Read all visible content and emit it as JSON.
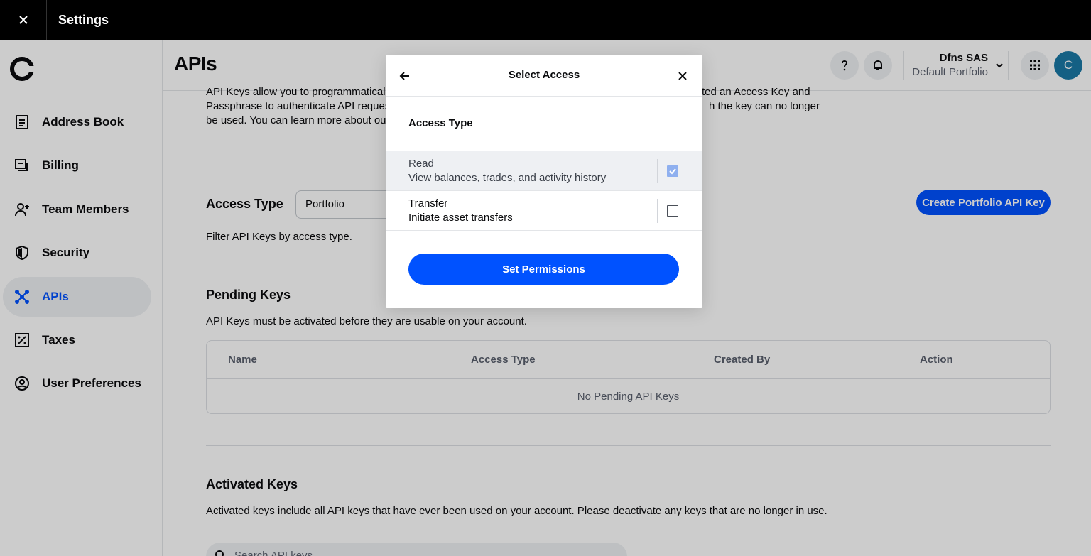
{
  "window": {
    "title": "Settings"
  },
  "sidebar": {
    "items": [
      {
        "label": "Address Book",
        "icon": "address-book-icon"
      },
      {
        "label": "Billing",
        "icon": "billing-icon"
      },
      {
        "label": "Team Members",
        "icon": "team-members-icon"
      },
      {
        "label": "Security",
        "icon": "shield-icon"
      },
      {
        "label": "APIs",
        "icon": "api-icon",
        "active": true
      },
      {
        "label": "Taxes",
        "icon": "taxes-icon"
      },
      {
        "label": "User Preferences",
        "icon": "user-circle-icon"
      }
    ]
  },
  "header": {
    "title": "APIs",
    "account_name": "Dfns SAS",
    "account_sub": "Default Portfolio",
    "avatar_letter": "C"
  },
  "main": {
    "intro_line1": "API Keys allow you to programmaticall",
    "intro_line1_right": "ted an Access Key and",
    "intro_line2": "Passphrase to authenticate API reques",
    "intro_line2_right": "h the key can no longer",
    "intro_line3": "be used. You can learn more about our",
    "access_type_label": "Access Type",
    "access_type_value": "Portfolio",
    "filter_help": "Filter API Keys by access type.",
    "create_button": "Create Portfolio API Key",
    "pending_title": "Pending Keys",
    "pending_desc": "API Keys must be activated before they are usable on your account.",
    "table": {
      "headers": [
        "Name",
        "Access Type",
        "Created By",
        "Action"
      ],
      "empty": "No Pending API Keys"
    },
    "activated_title": "Activated Keys",
    "activated_desc": "Activated keys include all API keys that have ever been used on your account. Please deactivate any keys that are no longer in use.",
    "search_placeholder": "Search API keys"
  },
  "modal": {
    "title": "Select Access",
    "subtitle": "Access Type",
    "options": [
      {
        "title": "Read",
        "desc": "View balances, trades, and activity history",
        "checked": true
      },
      {
        "title": "Transfer",
        "desc": "Initiate asset transfers",
        "checked": false
      }
    ],
    "primary_button": "Set Permissions"
  },
  "colors": {
    "accent": "#0052ff",
    "topbar": "#000000",
    "avatar": "#1a79a6"
  }
}
